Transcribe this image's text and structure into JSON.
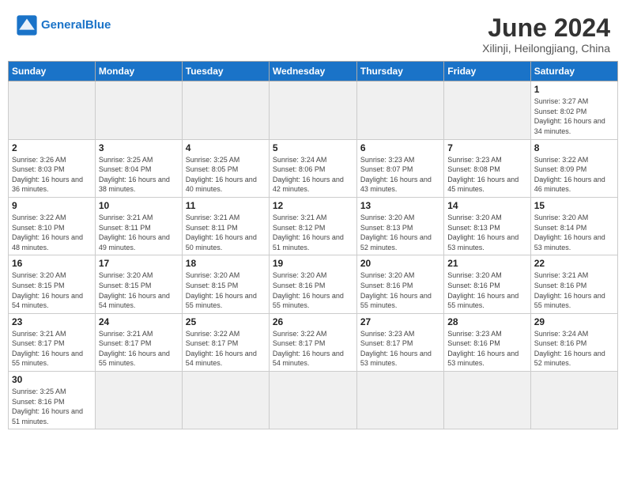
{
  "header": {
    "logo_line1": "General",
    "logo_line2": "Blue",
    "calendar_title": "June 2024",
    "calendar_subtitle": "Xilinji, Heilongjiang, China"
  },
  "weekdays": [
    "Sunday",
    "Monday",
    "Tuesday",
    "Wednesday",
    "Thursday",
    "Friday",
    "Saturday"
  ],
  "weeks": [
    [
      {
        "day": "",
        "empty": true
      },
      {
        "day": "",
        "empty": true
      },
      {
        "day": "",
        "empty": true
      },
      {
        "day": "",
        "empty": true
      },
      {
        "day": "",
        "empty": true
      },
      {
        "day": "",
        "empty": true
      },
      {
        "day": "1",
        "sunrise": "3:27 AM",
        "sunset": "8:02 PM",
        "daylight": "16 hours and 34 minutes."
      }
    ],
    [
      {
        "day": "2",
        "sunrise": "3:26 AM",
        "sunset": "8:03 PM",
        "daylight": "16 hours and 36 minutes."
      },
      {
        "day": "3",
        "sunrise": "3:25 AM",
        "sunset": "8:04 PM",
        "daylight": "16 hours and 38 minutes."
      },
      {
        "day": "4",
        "sunrise": "3:25 AM",
        "sunset": "8:05 PM",
        "daylight": "16 hours and 40 minutes."
      },
      {
        "day": "5",
        "sunrise": "3:24 AM",
        "sunset": "8:06 PM",
        "daylight": "16 hours and 42 minutes."
      },
      {
        "day": "6",
        "sunrise": "3:23 AM",
        "sunset": "8:07 PM",
        "daylight": "16 hours and 43 minutes."
      },
      {
        "day": "7",
        "sunrise": "3:23 AM",
        "sunset": "8:08 PM",
        "daylight": "16 hours and 45 minutes."
      },
      {
        "day": "8",
        "sunrise": "3:22 AM",
        "sunset": "8:09 PM",
        "daylight": "16 hours and 46 minutes."
      }
    ],
    [
      {
        "day": "9",
        "sunrise": "3:22 AM",
        "sunset": "8:10 PM",
        "daylight": "16 hours and 48 minutes."
      },
      {
        "day": "10",
        "sunrise": "3:21 AM",
        "sunset": "8:11 PM",
        "daylight": "16 hours and 49 minutes."
      },
      {
        "day": "11",
        "sunrise": "3:21 AM",
        "sunset": "8:11 PM",
        "daylight": "16 hours and 50 minutes."
      },
      {
        "day": "12",
        "sunrise": "3:21 AM",
        "sunset": "8:12 PM",
        "daylight": "16 hours and 51 minutes."
      },
      {
        "day": "13",
        "sunrise": "3:20 AM",
        "sunset": "8:13 PM",
        "daylight": "16 hours and 52 minutes."
      },
      {
        "day": "14",
        "sunrise": "3:20 AM",
        "sunset": "8:13 PM",
        "daylight": "16 hours and 53 minutes."
      },
      {
        "day": "15",
        "sunrise": "3:20 AM",
        "sunset": "8:14 PM",
        "daylight": "16 hours and 53 minutes."
      }
    ],
    [
      {
        "day": "16",
        "sunrise": "3:20 AM",
        "sunset": "8:15 PM",
        "daylight": "16 hours and 54 minutes."
      },
      {
        "day": "17",
        "sunrise": "3:20 AM",
        "sunset": "8:15 PM",
        "daylight": "16 hours and 54 minutes."
      },
      {
        "day": "18",
        "sunrise": "3:20 AM",
        "sunset": "8:15 PM",
        "daylight": "16 hours and 55 minutes."
      },
      {
        "day": "19",
        "sunrise": "3:20 AM",
        "sunset": "8:16 PM",
        "daylight": "16 hours and 55 minutes."
      },
      {
        "day": "20",
        "sunrise": "3:20 AM",
        "sunset": "8:16 PM",
        "daylight": "16 hours and 55 minutes."
      },
      {
        "day": "21",
        "sunrise": "3:20 AM",
        "sunset": "8:16 PM",
        "daylight": "16 hours and 55 minutes."
      },
      {
        "day": "22",
        "sunrise": "3:21 AM",
        "sunset": "8:16 PM",
        "daylight": "16 hours and 55 minutes."
      }
    ],
    [
      {
        "day": "23",
        "sunrise": "3:21 AM",
        "sunset": "8:17 PM",
        "daylight": "16 hours and 55 minutes."
      },
      {
        "day": "24",
        "sunrise": "3:21 AM",
        "sunset": "8:17 PM",
        "daylight": "16 hours and 55 minutes."
      },
      {
        "day": "25",
        "sunrise": "3:22 AM",
        "sunset": "8:17 PM",
        "daylight": "16 hours and 54 minutes."
      },
      {
        "day": "26",
        "sunrise": "3:22 AM",
        "sunset": "8:17 PM",
        "daylight": "16 hours and 54 minutes."
      },
      {
        "day": "27",
        "sunrise": "3:23 AM",
        "sunset": "8:17 PM",
        "daylight": "16 hours and 53 minutes."
      },
      {
        "day": "28",
        "sunrise": "3:23 AM",
        "sunset": "8:16 PM",
        "daylight": "16 hours and 53 minutes."
      },
      {
        "day": "29",
        "sunrise": "3:24 AM",
        "sunset": "8:16 PM",
        "daylight": "16 hours and 52 minutes."
      }
    ],
    [
      {
        "day": "30",
        "sunrise": "3:25 AM",
        "sunset": "8:16 PM",
        "daylight": "16 hours and 51 minutes."
      },
      {
        "day": "",
        "empty": true
      },
      {
        "day": "",
        "empty": true
      },
      {
        "day": "",
        "empty": true
      },
      {
        "day": "",
        "empty": true
      },
      {
        "day": "",
        "empty": true
      },
      {
        "day": "",
        "empty": true
      }
    ]
  ]
}
